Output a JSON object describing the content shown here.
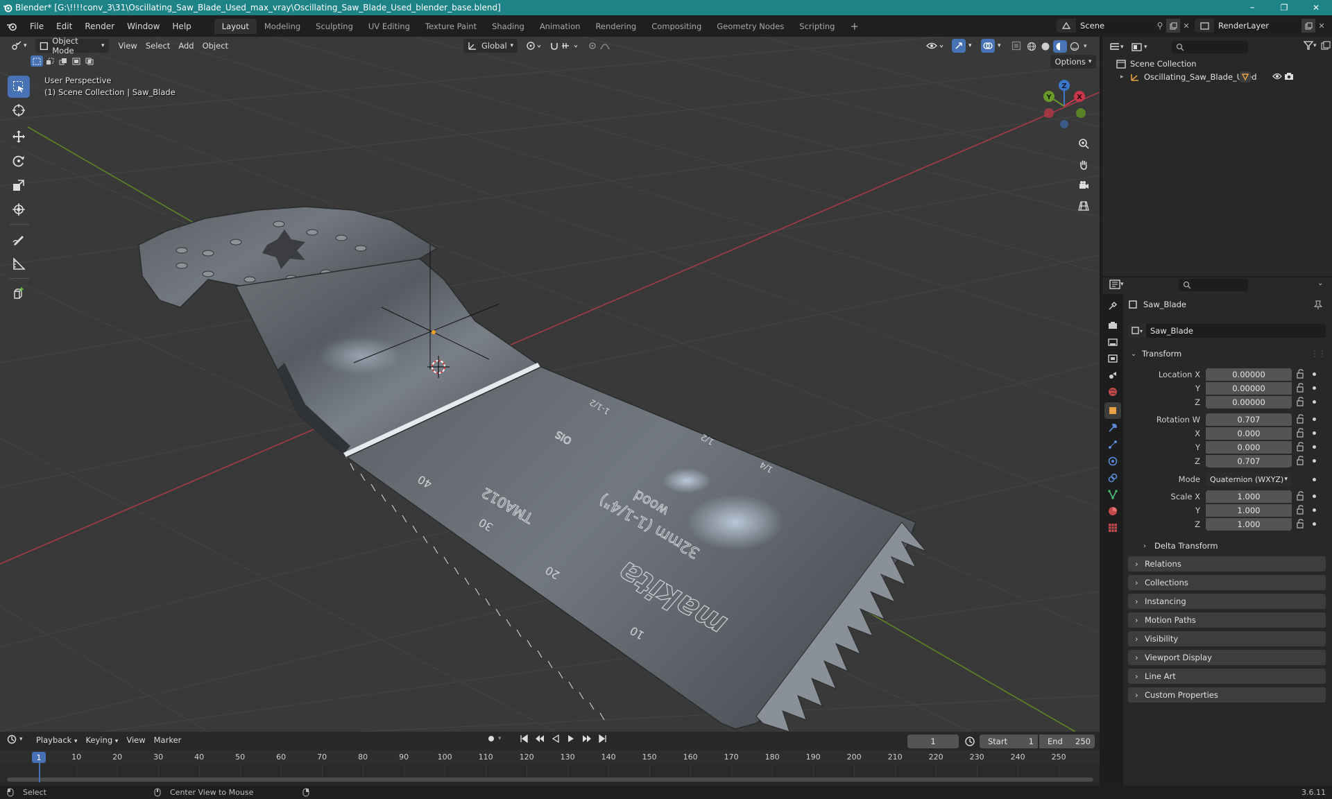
{
  "window": {
    "title": "Blender* [G:\\!!!!conv_3\\31\\Oscillating_Saw_Blade_Used_max_vray\\Oscillating_Saw_Blade_Used_blender_base.blend]",
    "minimize": "–",
    "maximize": "❐",
    "close": "✕"
  },
  "menu": [
    "File",
    "Edit",
    "Render",
    "Window",
    "Help"
  ],
  "workspaces": [
    "Layout",
    "Modeling",
    "Sculpting",
    "UV Editing",
    "Texture Paint",
    "Shading",
    "Animation",
    "Rendering",
    "Compositing",
    "Geometry Nodes",
    "Scripting"
  ],
  "active_workspace": "Layout",
  "add_workspace": "+",
  "scene": {
    "name": "Scene",
    "view_layer": "RenderLayer"
  },
  "viewport": {
    "mode": "Object Mode",
    "menus": [
      "View",
      "Select",
      "Add",
      "Object"
    ],
    "orientation": "Global",
    "options": "Options",
    "overlay_line1": "User Perspective",
    "overlay_line2": "(1) Scene Collection | Saw_Blade",
    "gizmo": {
      "z": "Z",
      "y": "Y",
      "x": "X"
    }
  },
  "outliner": {
    "root": "Scene Collection",
    "items": [
      {
        "label": "Oscillating_Saw_Blade_Used"
      }
    ]
  },
  "properties": {
    "object_name": "Saw_Blade",
    "data_name": "Saw_Blade",
    "transform_header": "Transform",
    "location": {
      "label": "Location X",
      "x": "0.00000",
      "y": "0.00000",
      "z": "0.00000"
    },
    "rotation": {
      "label": "Rotation W",
      "w": "0.707",
      "x": "0.000",
      "y": "0.000",
      "z": "0.707"
    },
    "mode_label": "Mode",
    "mode_value": "Quaternion (WXYZ)",
    "scale": {
      "label": "Scale X",
      "x": "1.000",
      "y": "1.000",
      "z": "1.000"
    },
    "axis": {
      "y": "Y",
      "z": "Z",
      "x": "X"
    },
    "delta": "Delta Transform",
    "sections": [
      "Relations",
      "Collections",
      "Instancing",
      "Motion Paths",
      "Visibility",
      "Viewport Display",
      "Line Art",
      "Custom Properties"
    ]
  },
  "timeline": {
    "menus": [
      "Playback",
      "Keying",
      "View",
      "Marker"
    ],
    "current_frame": "1",
    "start_label": "Start",
    "start": "1",
    "end_label": "End",
    "end": "250",
    "ruler": [
      "1",
      "10",
      "20",
      "30",
      "40",
      "50",
      "60",
      "70",
      "80",
      "90",
      "100",
      "110",
      "120",
      "130",
      "140",
      "150",
      "160",
      "170",
      "180",
      "190",
      "200",
      "210",
      "220",
      "230",
      "240",
      "250"
    ]
  },
  "status": {
    "select": "Select",
    "center": "Center View to Mouse",
    "version": "3.6.11"
  },
  "blade_text": {
    "brand": "makita",
    "size": "32mm (1-1/4\")",
    "material": "wood",
    "code": "TMA012",
    "ois": "OIS",
    "scale_marks": [
      "10",
      "20",
      "30",
      "40",
      "1/4",
      "1/2",
      "1-1/2"
    ]
  },
  "colors": {
    "accent": "#4772b3",
    "titlebar": "#1d8386",
    "viewport_bg": "#393939",
    "x_axis": "#c8384a",
    "y_axis": "#6a9a2a",
    "z_axis": "#3c78c8"
  }
}
